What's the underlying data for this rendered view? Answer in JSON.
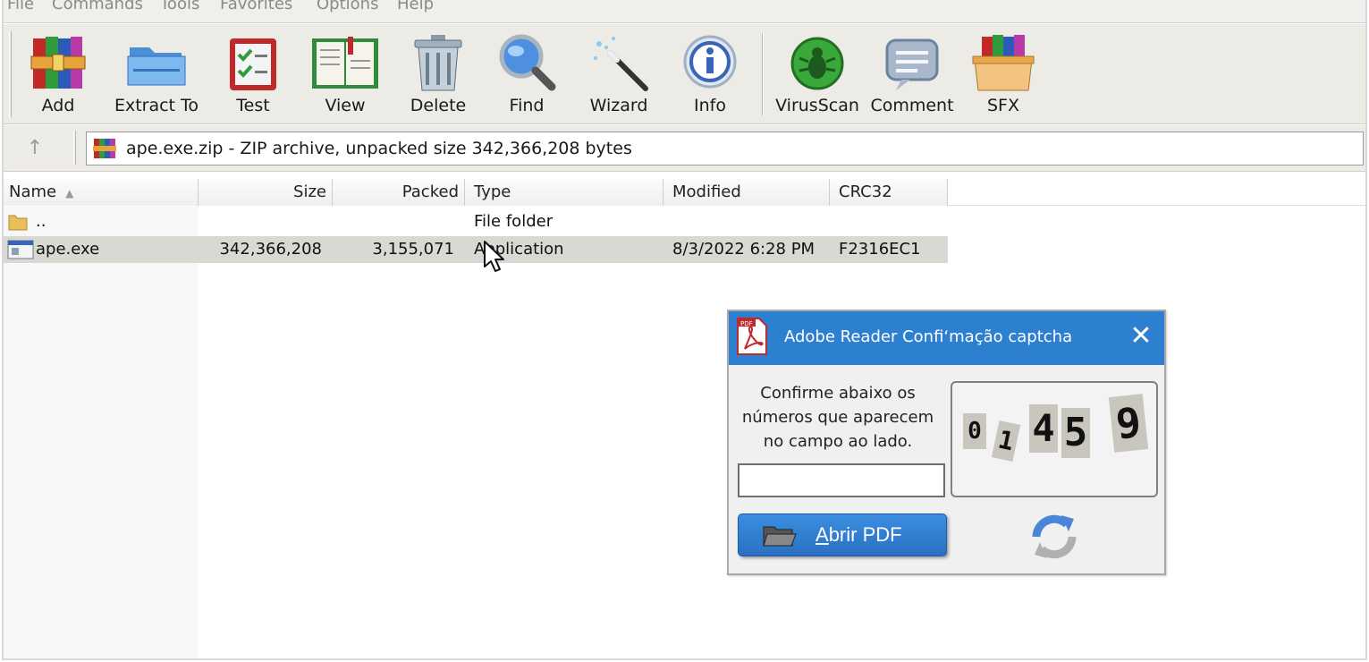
{
  "menu": [
    "File",
    "Commands",
    "Tools",
    "Favorites",
    "Options",
    "Help"
  ],
  "toolbar": {
    "buttons": [
      {
        "label": "Add",
        "icon": "winrar-books-icon"
      },
      {
        "label": "Extract To",
        "icon": "folder-icon"
      },
      {
        "label": "Test",
        "icon": "checklist-icon"
      },
      {
        "label": "View",
        "icon": "open-book-icon"
      },
      {
        "label": "Delete",
        "icon": "trash-icon"
      },
      {
        "label": "Find",
        "icon": "magnifier-icon"
      },
      {
        "label": "Wizard",
        "icon": "magic-wand-icon"
      },
      {
        "label": "Info",
        "icon": "info-icon"
      },
      {
        "label": "VirusScan",
        "icon": "bug-icon"
      },
      {
        "label": "Comment",
        "icon": "comment-icon"
      },
      {
        "label": "SFX",
        "icon": "sfx-box-icon"
      }
    ]
  },
  "address": {
    "up_icon": "↑",
    "path": "ape.exe.zip - ZIP archive, unpacked size 342,366,208 bytes"
  },
  "columns": [
    "Name",
    "Size",
    "Packed",
    "Type",
    "Modified",
    "CRC32"
  ],
  "files": [
    {
      "name": "..",
      "size": "",
      "packed": "",
      "type": "File folder",
      "modified": "",
      "crc": ""
    },
    {
      "name": "ape.exe",
      "size": "342,366,208",
      "packed": "3,155,071",
      "type": "Application",
      "modified": "8/3/2022 6:28 PM",
      "crc": "F2316EC1"
    }
  ],
  "popup": {
    "title": "Adobe Reader Confiʻmação captcha",
    "close": "✕",
    "instruction": [
      "Confirme abaixo os",
      "números que aparecem",
      "no campo ao lado."
    ],
    "input_value": "",
    "captcha_digits": [
      "0",
      "1",
      "4",
      "5",
      "9"
    ],
    "button_label_underlined": "A",
    "button_label_rest": "brir PDF",
    "accent": "#2d7fd0"
  }
}
